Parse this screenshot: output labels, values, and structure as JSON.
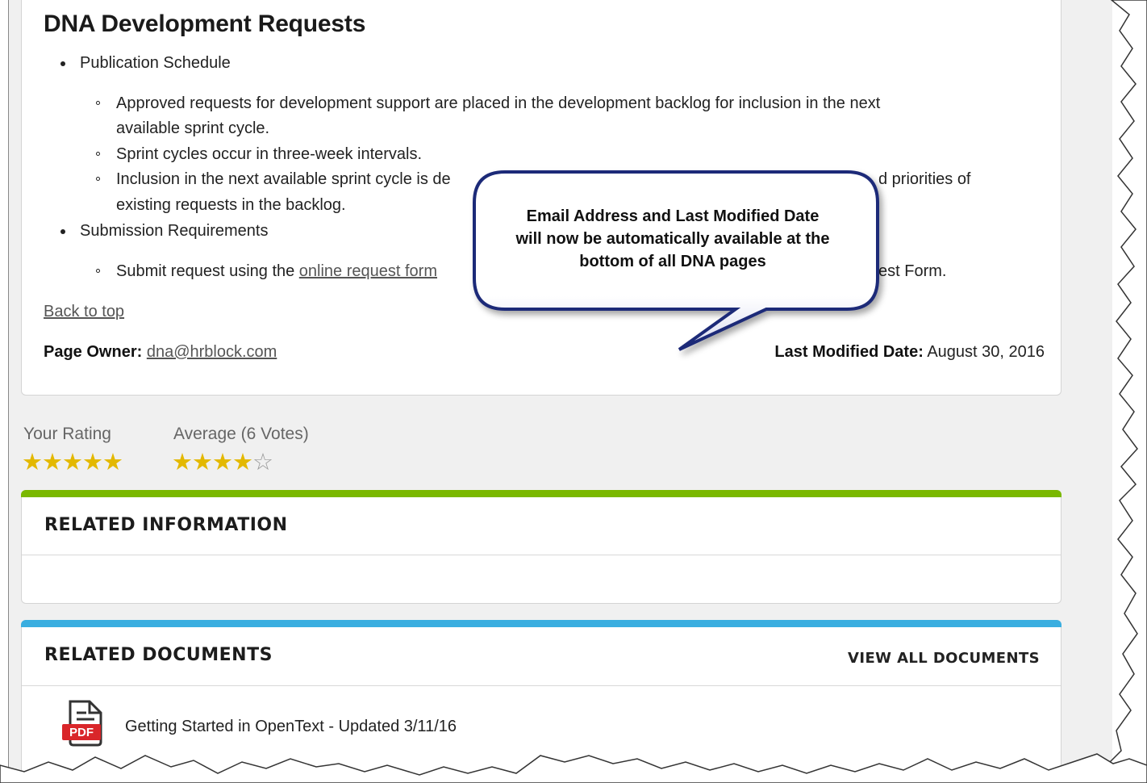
{
  "page": {
    "title": "DNA Development Requests"
  },
  "content": {
    "bullets": [
      {
        "label": "Publication Schedule",
        "subs": [
          [
            "Approved requests for development support are placed in the development backlog for inclusion in the next",
            "available sprint cycle."
          ],
          [
            "Sprint cycles occur in three-week intervals."
          ],
          [
            "Inclusion in the next available sprint cycle is de",
            "d priorities of"
          ],
          [
            "existing requests in the backlog."
          ]
        ]
      },
      {
        "label": "Submission Requirements",
        "subs": [
          [
            "Submit request using the ",
            "online request form",
            "est Form."
          ]
        ]
      }
    ],
    "back_to_top": "Back to top",
    "page_owner_label": "Page Owner:",
    "page_owner_email": "dna@hrblock.com",
    "last_modified_label": "Last Modified Date:",
    "last_modified_value": "August 30, 2016"
  },
  "callout": {
    "lines": [
      "Email Address and Last Modified Date",
      "will now be automatically available at the",
      "bottom of all DNA pages"
    ]
  },
  "rating": {
    "your_label": "Your Rating",
    "your_value": 5,
    "your_max": 5,
    "average_label": "Average (6 Votes)",
    "average_value": 4,
    "average_max": 5
  },
  "related_information": {
    "title": "RELATED INFORMATION",
    "accent": "#7ab800"
  },
  "related_documents": {
    "title": "RELATED DOCUMENTS",
    "view_all": "VIEW ALL DOCUMENTS",
    "accent": "#3aaee0",
    "items": [
      {
        "icon": "pdf-icon",
        "icon_label": "PDF",
        "title": "Getting Started in OpenText - Updated 3/11/16"
      }
    ]
  },
  "colors": {
    "star": "#e3b800",
    "star_empty": "#9a9a9a",
    "callout_fill": "#ffffff",
    "callout_border": "#1f2a78"
  }
}
